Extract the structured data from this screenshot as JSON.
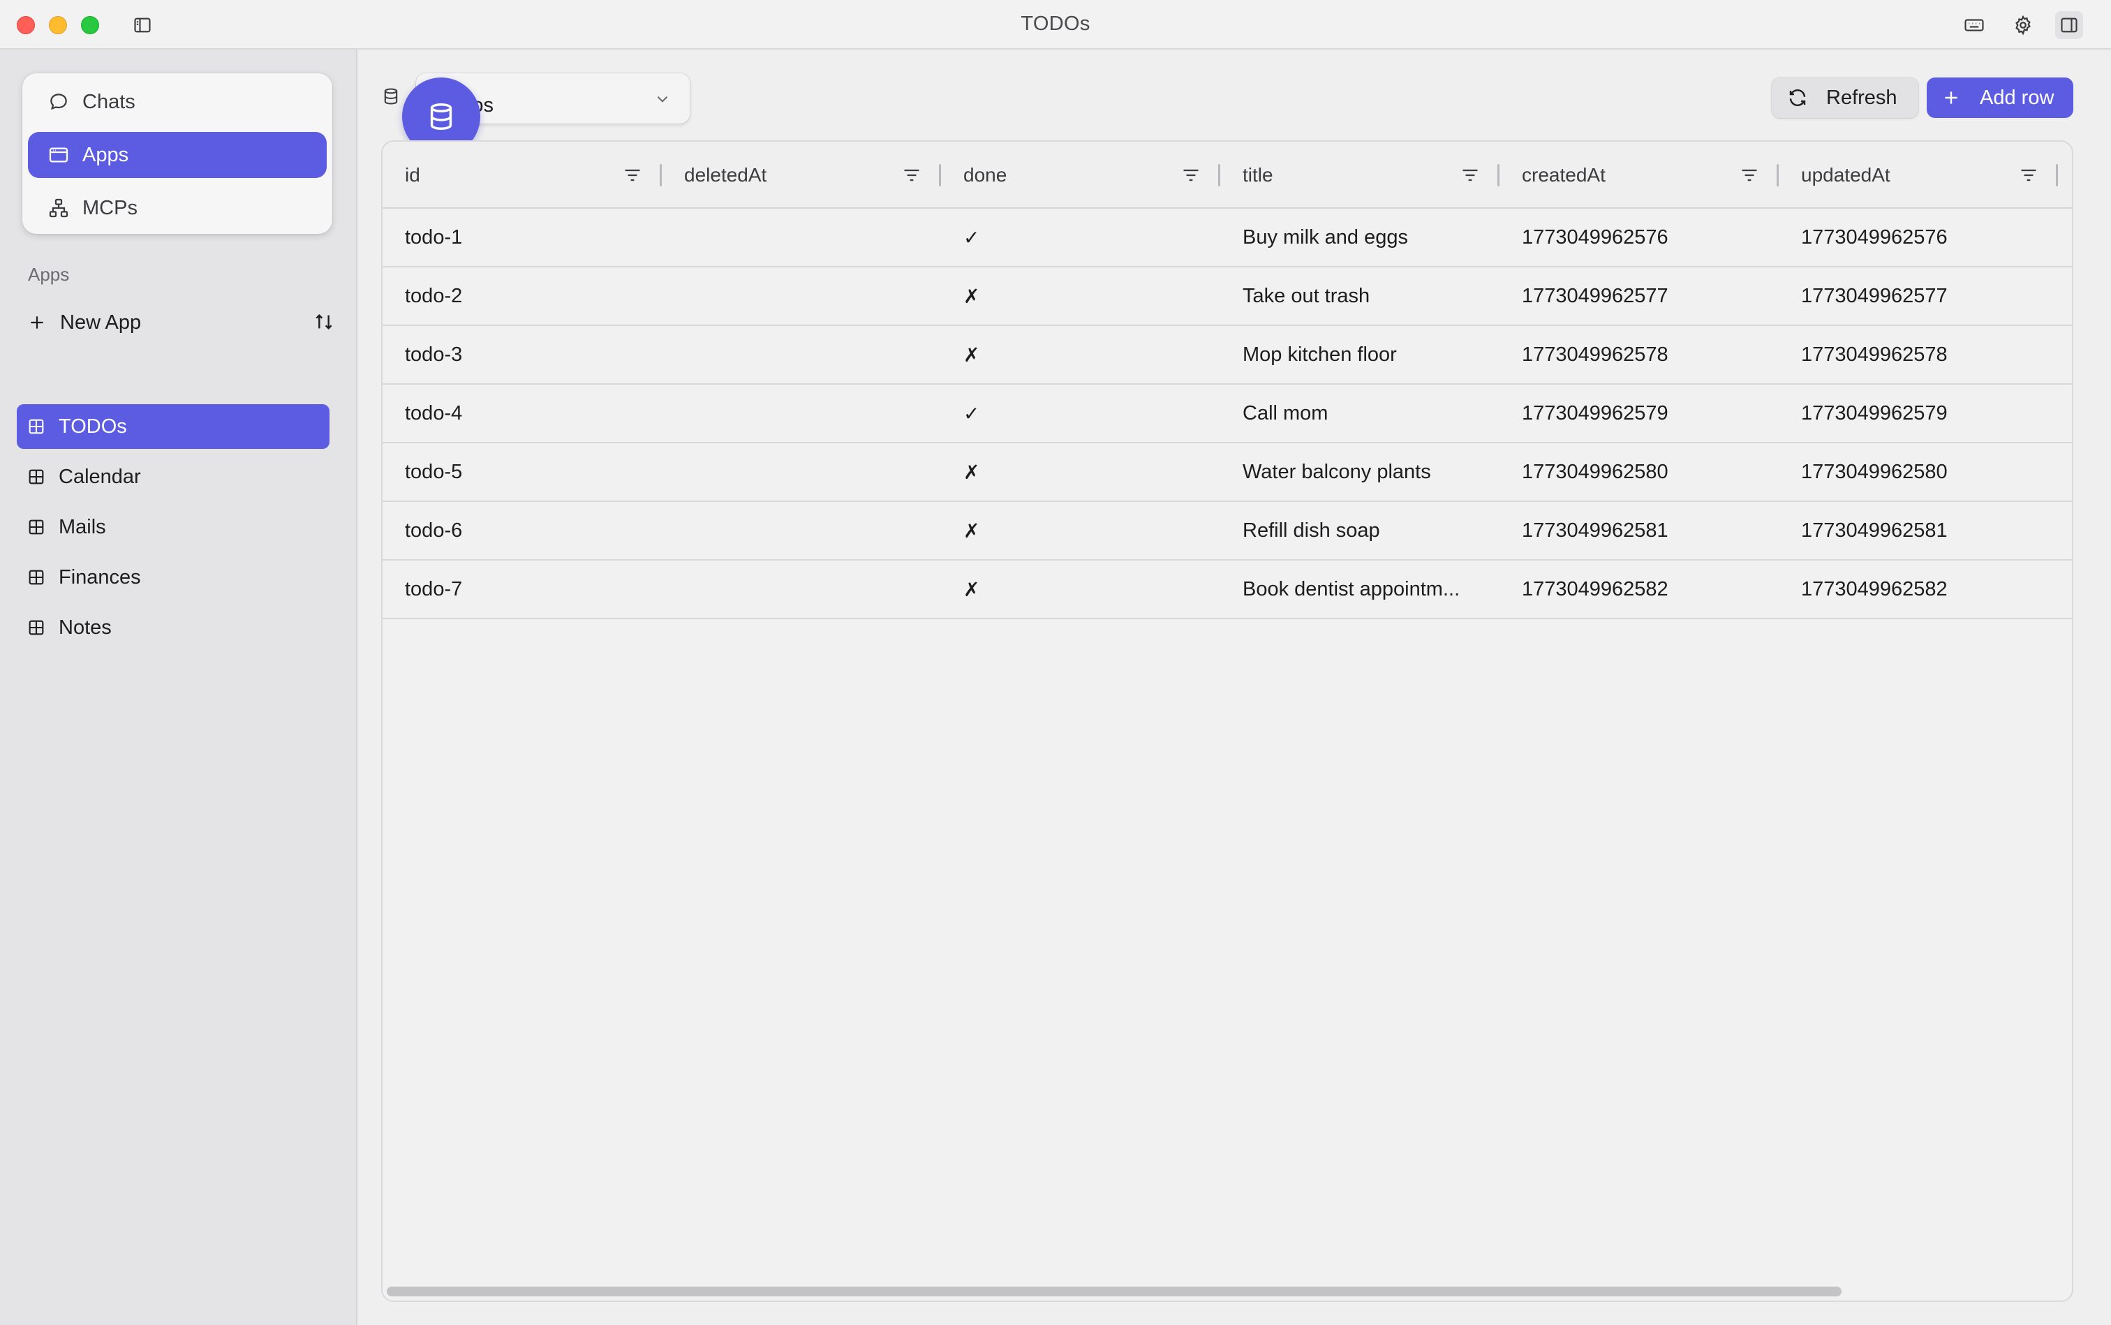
{
  "window": {
    "title": "TODOs"
  },
  "modes": [
    {
      "label": "Chats",
      "icon": "chat-bubble-icon",
      "active": false
    },
    {
      "label": "Apps",
      "icon": "app-window-icon",
      "active": true
    },
    {
      "label": "MCPs",
      "icon": "network-icon",
      "active": false
    }
  ],
  "sidebar": {
    "section_label": "Apps",
    "new_app_label": "New App",
    "apps": [
      {
        "label": "TODOs",
        "active": true
      },
      {
        "label": "Calendar",
        "active": false
      },
      {
        "label": "Mails",
        "active": false
      },
      {
        "label": "Finances",
        "active": false
      },
      {
        "label": "Notes",
        "active": false
      }
    ]
  },
  "toolbar": {
    "table_select_value": "todos",
    "refresh_label": "Refresh",
    "add_row_label": "Add row"
  },
  "table": {
    "columns": [
      "id",
      "deletedAt",
      "done",
      "title",
      "createdAt",
      "updatedAt"
    ],
    "rows": [
      {
        "id": "todo-1",
        "deletedAt": "",
        "done": "✓",
        "title": "Buy milk and eggs",
        "createdAt": "1773049962576",
        "updatedAt": "1773049962576"
      },
      {
        "id": "todo-2",
        "deletedAt": "",
        "done": "✗",
        "title": "Take out trash",
        "createdAt": "1773049962577",
        "updatedAt": "1773049962577"
      },
      {
        "id": "todo-3",
        "deletedAt": "",
        "done": "✗",
        "title": "Mop kitchen floor",
        "createdAt": "1773049962578",
        "updatedAt": "1773049962578"
      },
      {
        "id": "todo-4",
        "deletedAt": "",
        "done": "✓",
        "title": "Call mom",
        "createdAt": "1773049962579",
        "updatedAt": "1773049962579"
      },
      {
        "id": "todo-5",
        "deletedAt": "",
        "done": "✗",
        "title": "Water balcony plants",
        "createdAt": "1773049962580",
        "updatedAt": "1773049962580"
      },
      {
        "id": "todo-6",
        "deletedAt": "",
        "done": "✗",
        "title": "Refill dish soap",
        "createdAt": "1773049962581",
        "updatedAt": "1773049962581"
      },
      {
        "id": "todo-7",
        "deletedAt": "",
        "done": "✗",
        "title": "Book dentist appointm...",
        "createdAt": "1773049962582",
        "updatedAt": "1773049962582"
      }
    ]
  },
  "colors": {
    "accent": "#5b5ce2",
    "sidebar_bg": "#e4e4e6",
    "main_bg": "#efefef"
  }
}
